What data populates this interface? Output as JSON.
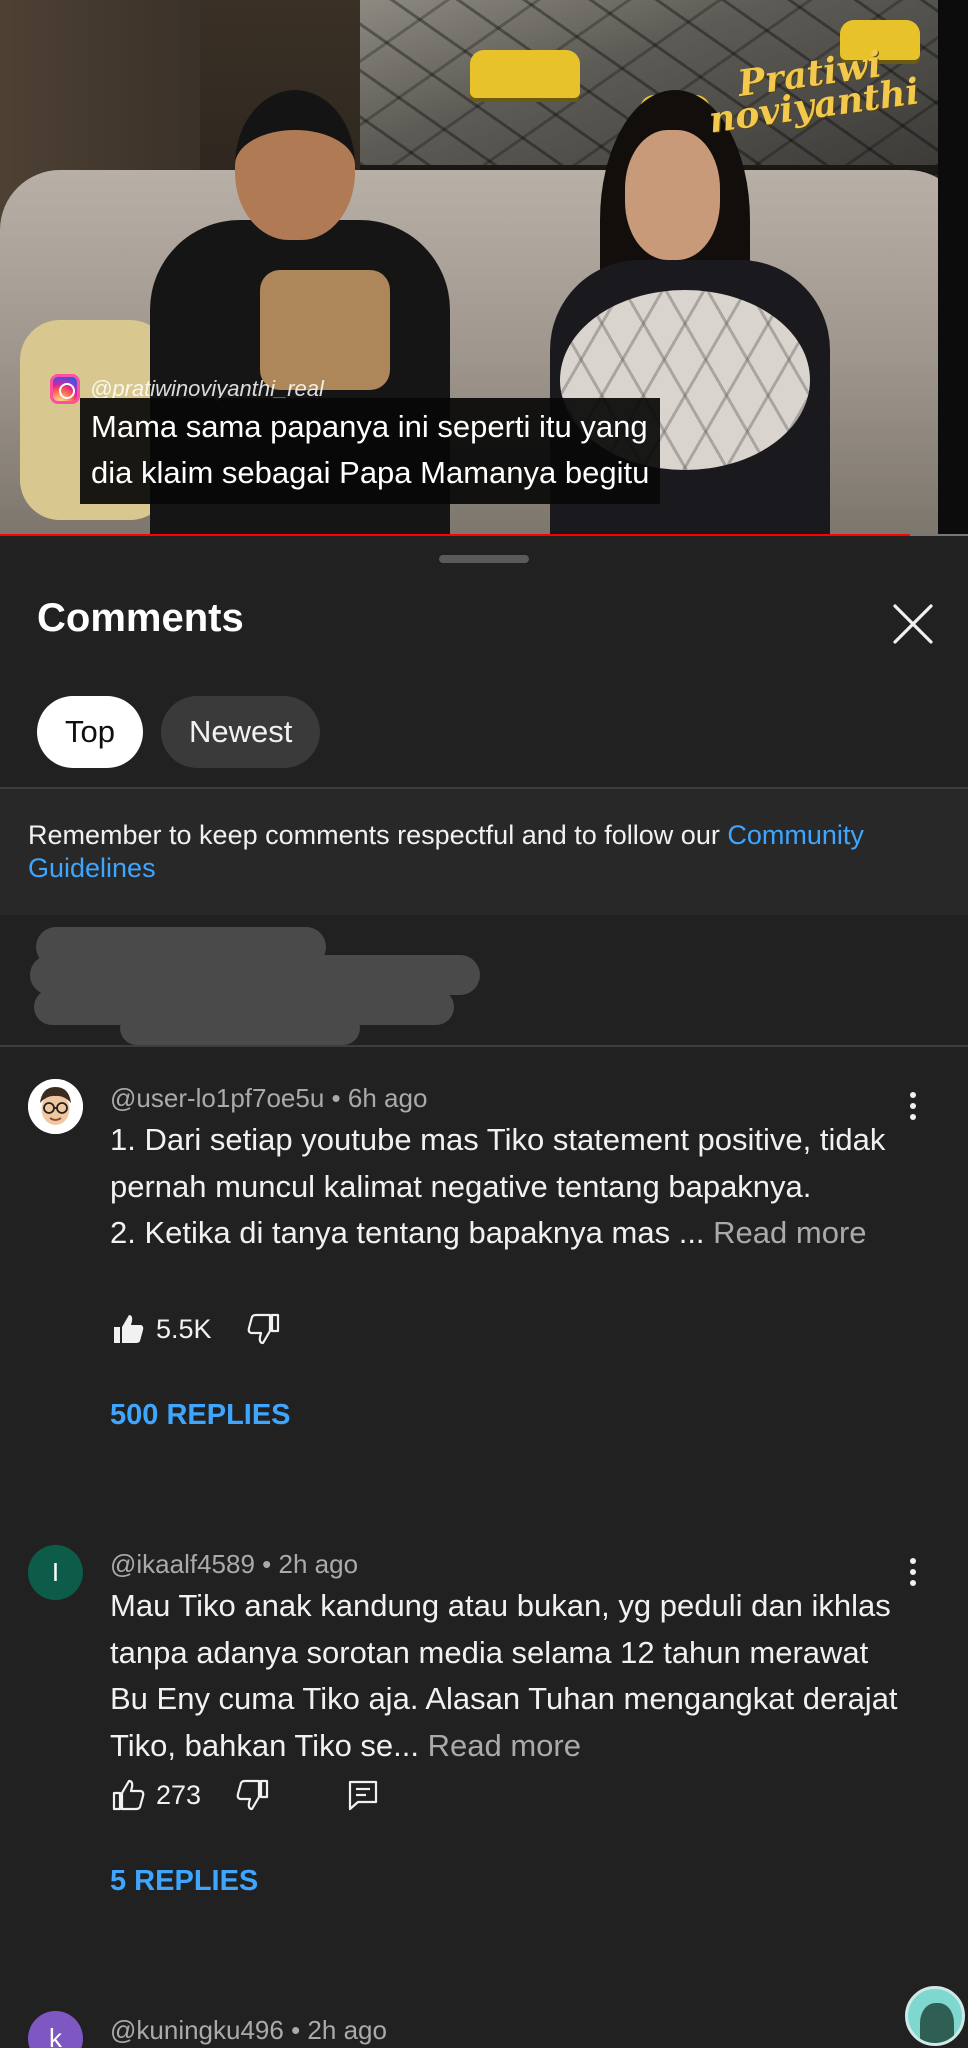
{
  "video": {
    "watermark_line1": "Pratiwi",
    "watermark_line2": "noviyanthi",
    "ig_handle": "@pratiwinoviyanthi_real",
    "caption": "Mama sama papanya ini seperti itu yang\ndia klaim sebagai Papa Mamanya begitu",
    "progress_fraction": 0.94,
    "colors": {
      "progress": "#ff0000",
      "watermark": "#f2c94c"
    }
  },
  "sheet": {
    "title": "Comments",
    "close_icon": "close-icon",
    "tabs": [
      {
        "label": "Top",
        "active": true
      },
      {
        "label": "Newest",
        "active": false
      }
    ],
    "guidelines_text": "Remember to keep comments respectful and to follow our ",
    "guidelines_link": "Community Guidelines"
  },
  "comments": [
    {
      "author": "@user-lo1pf7oe5u",
      "time": "6h ago",
      "text": "1. Dari setiap youtube mas Tiko statement positive, tidak pernah muncul kalimat negative tentang bapaknya.\n2. Ketika di tanya tentang bapaknya mas ...",
      "more": " Read more",
      "likes": "5.5K",
      "replies": "500 REPLIES",
      "avatar_letter": "",
      "avatar_color": "#ffffff"
    },
    {
      "author": "@ikaalf4589",
      "time": "2h ago",
      "text": "Mau Tiko anak kandung atau bukan, yg peduli dan ikhlas tanpa adanya sorotan media selama 12 tahun merawat Bu Eny cuma Tiko aja. Alasan Tuhan mengangkat derajat Tiko, bahkan Tiko se...",
      "more": " Read more",
      "likes": "273",
      "replies": "5 REPLIES",
      "avatar_letter": "I",
      "avatar_color": "#0d5c4a"
    },
    {
      "author": "@kuningku496",
      "time": "2h ago",
      "avatar_letter": "k",
      "avatar_color": "#7e57c2"
    }
  ],
  "colors": {
    "accent_link": "#3ea6ff",
    "background": "#212121"
  }
}
